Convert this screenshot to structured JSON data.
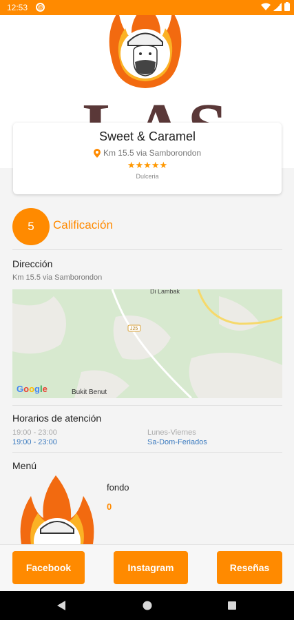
{
  "status_bar": {
    "time": "12:53",
    "notif_glyph": "@"
  },
  "hero": {
    "brand_text": "LAS"
  },
  "place": {
    "name": "Sweet & Caramel",
    "address": "Km 15.5 via Samborondon",
    "stars": "★★★★★",
    "category": "Dulceria"
  },
  "rating": {
    "value": "5",
    "label": "Calificación"
  },
  "direccion": {
    "title": "Dirección",
    "text": "Km 15.5 via Samborondon"
  },
  "map": {
    "google_letters": [
      "G",
      "o",
      "o",
      "g",
      "l",
      "e"
    ],
    "google_colors": [
      "#4285F4",
      "#EA4335",
      "#FBBC05",
      "#4285F4",
      "#34A853",
      "#EA4335"
    ],
    "place_label": "Bukit Benut",
    "top_label": "Di Lambak",
    "road_label": "J25"
  },
  "horarios": {
    "title": "Horarios de atención",
    "rows": [
      {
        "time": "19:00 - 23:00",
        "days": "Lunes-Viernes"
      },
      {
        "time": "19:00 - 23:00",
        "days": "Sa-Dom-Feriados"
      }
    ]
  },
  "menu": {
    "title": "Menú",
    "items": [
      {
        "name": "fondo",
        "price": "0"
      }
    ]
  },
  "actions": {
    "facebook": "Facebook",
    "instagram": "Instagram",
    "resenas": "Reseñas"
  },
  "colors": {
    "accent": "#ff8a00",
    "link": "#3c7bbf"
  }
}
